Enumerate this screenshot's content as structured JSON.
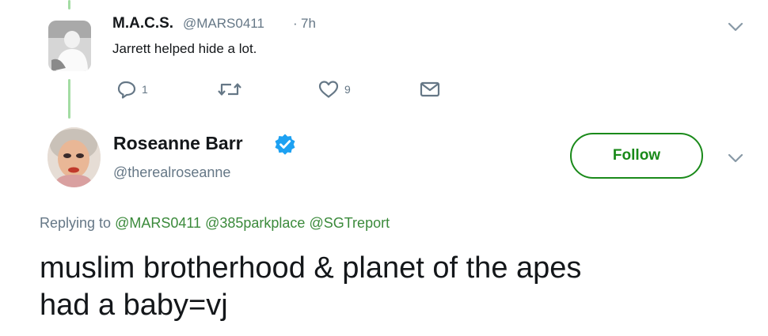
{
  "reply_tweet": {
    "name": "M.A.C.S.",
    "handle": "@MARS0411",
    "separator": "·",
    "time": "7h",
    "text": "Jarrett helped hide a lot.",
    "actions": {
      "reply_count": "1",
      "retweet_count": "",
      "like_count": "9"
    },
    "menu_icon": "chevron-down-icon"
  },
  "main_tweet": {
    "name": "Roseanne Barr",
    "verified_icon": "verified-badge-icon",
    "handle": "@therealroseanne",
    "follow_label": "Follow",
    "replying_label": "Replying to",
    "replying_to": [
      "@MARS0411",
      "@385parkplace",
      "@SGTreport"
    ],
    "text_line1": "muslim brotherhood & planet of the apes",
    "text_line2": "had a baby=vj",
    "menu_icon": "chevron-down-icon"
  },
  "colors": {
    "accent": "#1a8a1a",
    "thread_line": "#a3dca3",
    "secondary_text": "#657786",
    "verified_blue": "#1da1f2"
  }
}
